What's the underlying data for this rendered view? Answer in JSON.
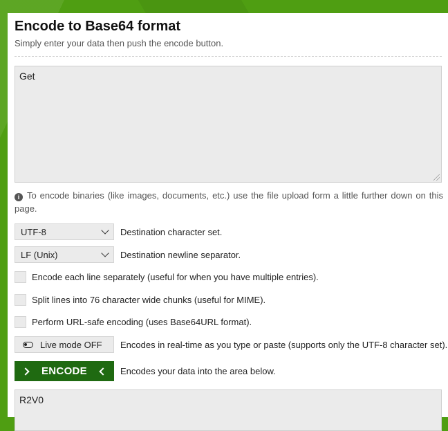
{
  "header": {
    "title": "Encode to Base64 format",
    "subtitle": "Simply enter your data then push the encode button."
  },
  "input": {
    "value": "Get"
  },
  "info": {
    "icon": "info-icon",
    "text": "To encode binaries (like images, documents, etc.) use the file upload form a little further down on this page."
  },
  "options": {
    "charset": {
      "selected": "UTF-8",
      "label": "Destination character set."
    },
    "newline": {
      "selected": "LF (Unix)",
      "label": "Destination newline separator."
    },
    "checkboxes": [
      {
        "label": "Encode each line separately (useful for when you have multiple entries).",
        "checked": false
      },
      {
        "label": "Split lines into 76 character wide chunks (useful for MIME).",
        "checked": false
      },
      {
        "label": "Perform URL-safe encoding (uses Base64URL format).",
        "checked": false
      }
    ],
    "live_mode": {
      "label": "Live mode OFF",
      "description": "Encodes in real-time as you type or paste (supports only the UTF-8 character set)."
    }
  },
  "encode": {
    "label": "ENCODE",
    "description": "Encodes your data into the area below."
  },
  "output": {
    "value": "R2V0"
  },
  "colors": {
    "brand_green": "#4f9e12",
    "button_green": "#1f6a11",
    "field_bg": "#ebebeb"
  }
}
